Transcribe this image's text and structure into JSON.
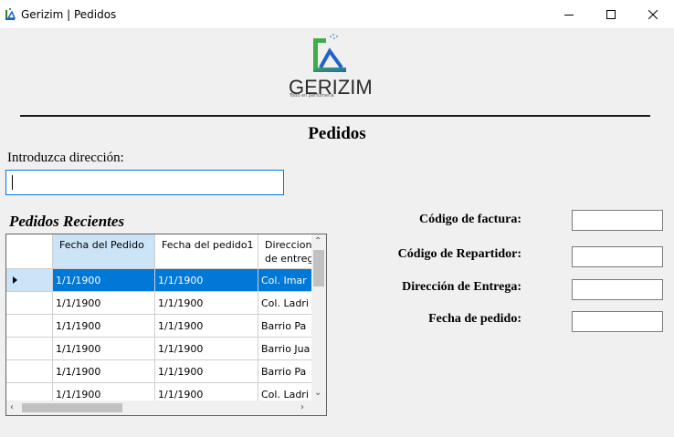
{
  "window": {
    "title": "Gerizim | Pedidos",
    "controls": [
      "minimize-icon",
      "maximize-icon",
      "close-icon"
    ]
  },
  "logo": {
    "name": "GERIZIM",
    "tagline": "Todo en perfumería"
  },
  "page": {
    "title": "Pedidos"
  },
  "address": {
    "label": "Introduzca dirección:",
    "value": ""
  },
  "recent": {
    "title": "Pedidos Recientes",
    "columns": [
      "Fecha del Pedido",
      "Fecha del pedido1",
      "Direccion de entrega"
    ],
    "rows": [
      [
        "1/1/1900",
        "1/1/1900",
        "Col. Imar"
      ],
      [
        "1/1/1900",
        "1/1/1900",
        "Col. Ladri"
      ],
      [
        "1/1/1900",
        "1/1/1900",
        "Barrio Pa"
      ],
      [
        "1/1/1900",
        "1/1/1900",
        "Barrio Jua"
      ],
      [
        "1/1/1900",
        "1/1/1900",
        "Barrio Pa"
      ],
      [
        "1/1/1900",
        "1/1/1900",
        "Col. Ladri"
      ]
    ],
    "selected_row": 0
  },
  "fields": {
    "codigo_factura": "Código de factura:",
    "codigo_repartidor": "Código de Repartidor:",
    "direccion_entrega": "Dirección de Entrega:",
    "fecha_pedido": "Fecha de pedido:"
  },
  "colors": {
    "accent": "#0078d7",
    "selection_light": "#cce4f7",
    "background": "#f0f0f0"
  }
}
